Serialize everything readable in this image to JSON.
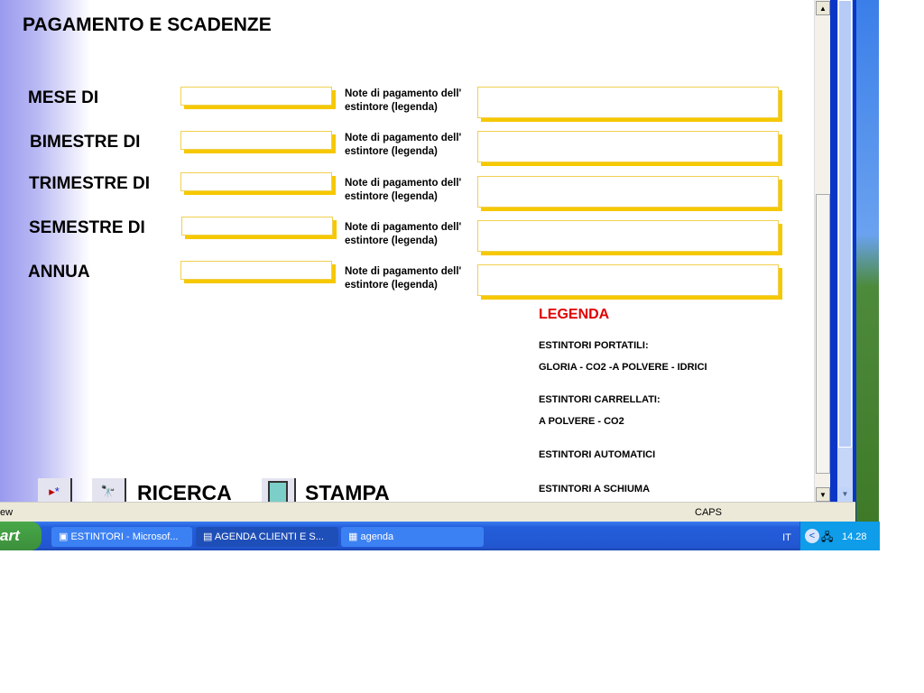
{
  "form": {
    "title": "PAGAMENTO E SCADENZE",
    "rows": [
      {
        "label": "MESE DI",
        "value": "",
        "note": "Note di pagamento dell' estintore (legenda)",
        "note_value": ""
      },
      {
        "label": "BIMESTRE DI",
        "value": "",
        "note": "Note di pagamento dell' estintore (legenda)",
        "note_value": ""
      },
      {
        "label": "TRIMESTRE DI",
        "value": "",
        "note": "Note di pagamento dell' estintore (legenda)",
        "note_value": ""
      },
      {
        "label": "SEMESTRE DI",
        "value": "",
        "note": "Note di pagamento dell' estintore (legenda)",
        "note_value": ""
      },
      {
        "label": "ANNUA",
        "value": "",
        "note": "Note di pagamento dell' estintore (legenda)",
        "note_value": ""
      }
    ],
    "legend": {
      "title": "LEGENDA",
      "title_color": "#e00000",
      "lines": [
        "ESTINTORI PORTATILI:",
        "GLORIA - CO2 -A POLVERE - IDRICI",
        "ESTINTORI CARRELLATI:",
        "A POLVERE - CO2",
        "ESTINTORI AUTOMATICI",
        "ESTINTORI A SCHIUMA"
      ]
    },
    "buttons": {
      "new_record_icon": "new-record-icon",
      "search": "RICERCA",
      "print": "STAMPA"
    }
  },
  "status": {
    "left": "ew",
    "caps": "CAPS"
  },
  "taskbar": {
    "start": "art",
    "tasks": [
      "ESTINTORI - Microsof...",
      "AGENDA CLIENTI  E S...",
      "agenda"
    ],
    "lang": "IT",
    "clock": "14.28"
  }
}
